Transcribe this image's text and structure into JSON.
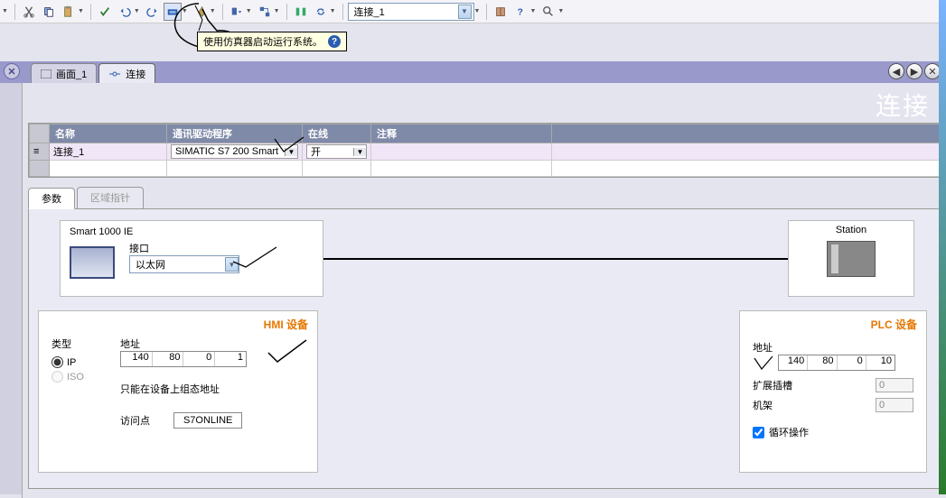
{
  "toolbar": {
    "combo_value": "连接_1",
    "tooltip": "使用仿真器启动运行系统。"
  },
  "tabs": {
    "tab1": "画面_1",
    "tab2": "连接"
  },
  "workspace_title": "连接",
  "table": {
    "headers": {
      "name": "名称",
      "driver": "通讯驱动程序",
      "online": "在线",
      "comment": "注释"
    },
    "row": {
      "name": "连接_1",
      "driver": "SIMATIC S7 200 Smart",
      "online": "开",
      "comment": ""
    }
  },
  "sub_tabs": {
    "params": "参数",
    "area": "区域指针"
  },
  "hmi_box": {
    "device": "Smart 1000 IE",
    "iface_label": "接口",
    "iface_value": "以太网"
  },
  "station_box": {
    "label": "Station"
  },
  "hmi_dev": {
    "title": "HMI 设备",
    "type_label": "类型",
    "opt_ip": "IP",
    "opt_iso": "ISO",
    "addr_label": "地址",
    "ip": [
      "140",
      "80",
      "0",
      "1"
    ],
    "note": "只能在设备上组态地址",
    "ap_label": "访问点",
    "ap_value": "S7ONLINE"
  },
  "plc_dev": {
    "title": "PLC 设备",
    "addr_label": "地址",
    "ip": [
      "140",
      "80",
      "0",
      "10"
    ],
    "slot_label": "扩展插槽",
    "slot_value": "0",
    "rack_label": "机架",
    "rack_value": "0",
    "cyclic_label": "循环操作"
  }
}
